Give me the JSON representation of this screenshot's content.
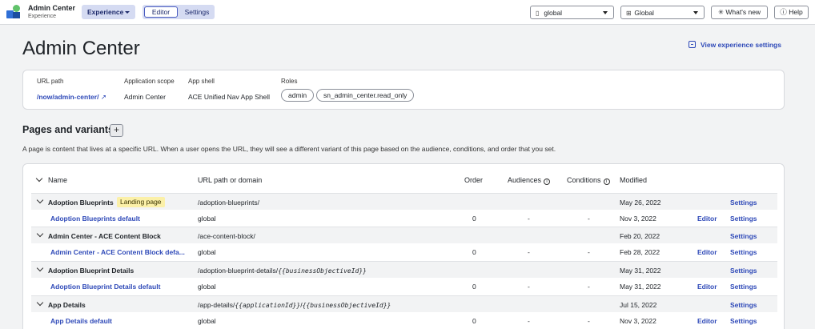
{
  "topbar": {
    "app_title": "Admin Center",
    "app_subtitle": "Experience",
    "experience_menu": "Experience",
    "tabs": [
      "Editor",
      "Settings"
    ],
    "scope_dropdown": "global",
    "app_dropdown": "Global",
    "whats_new": "What's new",
    "help": "Help"
  },
  "page": {
    "title": "Admin Center",
    "view_settings_link": "View experience settings"
  },
  "details": {
    "url_label": "URL path",
    "url_value": "/now/admin-center/",
    "scope_label": "Application scope",
    "scope_value": "Admin Center",
    "shell_label": "App shell",
    "shell_value": "ACE Unified Nav App Shell",
    "roles_label": "Roles",
    "roles": [
      "admin",
      "sn_admin_center.read_only"
    ]
  },
  "pages_section": {
    "title": "Pages and variants",
    "add_symbol": "+",
    "description": "A page is content that lives at a specific URL. When a user opens the URL, they will see a different variant of this page based on the audience, conditions, and order that you set."
  },
  "table": {
    "headers": {
      "name": "Name",
      "url": "URL path or domain",
      "order": "Order",
      "audiences": "Audiences",
      "conditions": "Conditions",
      "modified": "Modified"
    },
    "rows": [
      {
        "type": "page",
        "name": "Adoption Blueprints",
        "badge": "Landing page",
        "url": "/adoption-blueprints/",
        "modified": "May 26, 2022",
        "settings": "Settings"
      },
      {
        "type": "variant",
        "name": "Adoption Blueprints default",
        "url": "global",
        "order": "0",
        "audiences": "-",
        "conditions": "-",
        "modified": "Nov 3, 2022",
        "editor": "Editor",
        "settings": "Settings"
      },
      {
        "type": "page",
        "name": "Admin Center - ACE Content Block",
        "url": "/ace-content-block/",
        "modified": "Feb 20, 2022",
        "settings": "Settings"
      },
      {
        "type": "variant",
        "name": "Admin Center - ACE Content Block defa...",
        "url": "global",
        "order": "0",
        "audiences": "-",
        "conditions": "-",
        "modified": "Feb 28, 2022",
        "editor": "Editor",
        "settings": "Settings"
      },
      {
        "type": "page",
        "name": "Adoption Blueprint Details",
        "url_prefix": "/adoption-blueprint-details/",
        "url_param": "{{businessObjectiveId}}",
        "modified": "May 31, 2022",
        "settings": "Settings"
      },
      {
        "type": "variant",
        "name": "Adoption Blueprint Details default",
        "url": "global",
        "order": "0",
        "audiences": "-",
        "conditions": "-",
        "modified": "May 31, 2022",
        "editor": "Editor",
        "settings": "Settings"
      },
      {
        "type": "page",
        "name": "App Details",
        "url_prefix": "/app-details/",
        "url_param": "{{applicationId}}",
        "url_sep": "/",
        "url_param2": "{{businessObjectiveId}}",
        "modified": "Jul 15, 2022",
        "settings": "Settings"
      },
      {
        "type": "variant",
        "name": "App Details default",
        "url": "global",
        "order": "0",
        "audiences": "-",
        "conditions": "-",
        "modified": "Nov 3, 2022",
        "editor": "Editor",
        "settings": "Settings"
      }
    ]
  },
  "colors": {
    "accent": "#2e49b8",
    "badge_bg": "#fbf0a8",
    "page_row_bg": "#f2f3f4"
  }
}
